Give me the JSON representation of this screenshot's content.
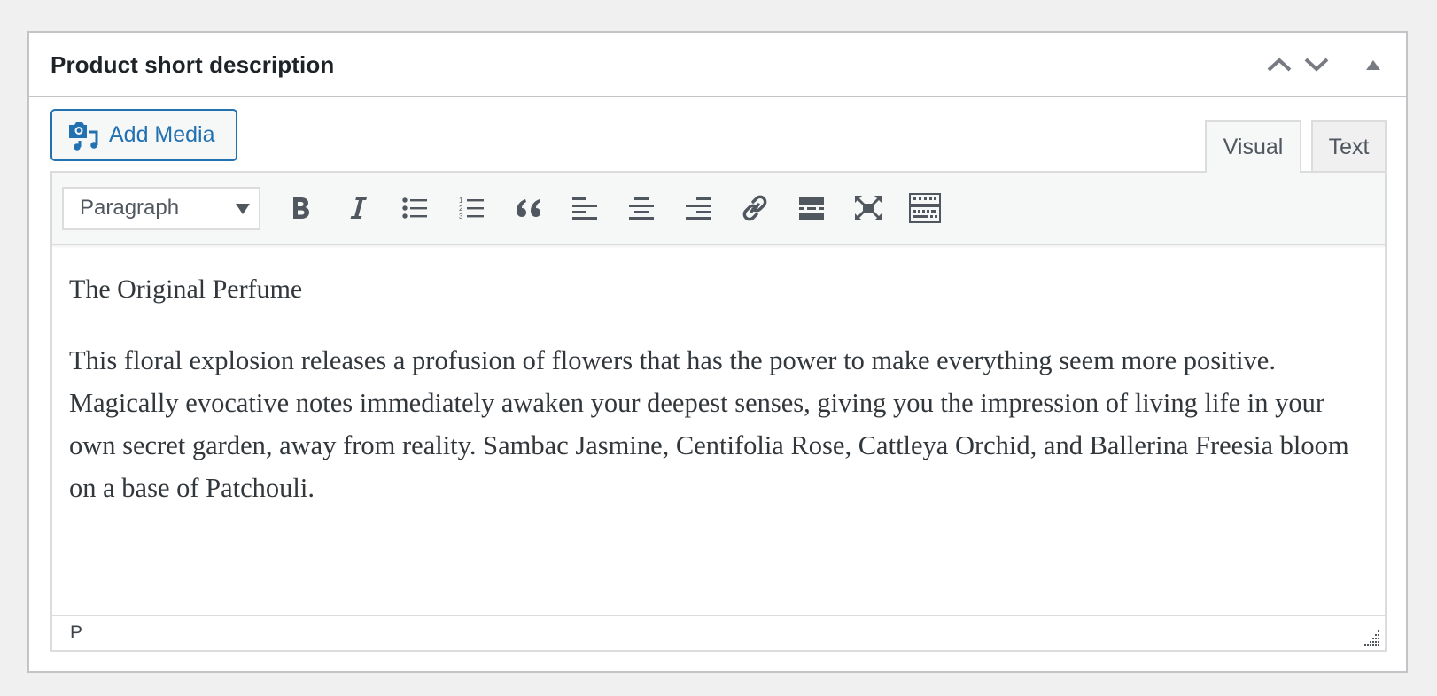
{
  "metabox": {
    "title": "Product short description",
    "actions": [
      {
        "name": "move-up",
        "icon": "chevron-up-icon"
      },
      {
        "name": "move-down",
        "icon": "chevron-down-icon"
      },
      {
        "name": "toggle-panel",
        "icon": "triangle-up-icon"
      }
    ]
  },
  "media": {
    "add_media_label": "Add Media",
    "icon": "media-camera-music-icon"
  },
  "editor_tabs": [
    {
      "label": "Visual",
      "active": true
    },
    {
      "label": "Text",
      "active": false
    }
  ],
  "toolbar": {
    "format_select": {
      "selected": "Paragraph"
    },
    "buttons": [
      {
        "name": "bold",
        "icon": "bold-icon"
      },
      {
        "name": "italic",
        "icon": "italic-icon"
      },
      {
        "name": "bulleted-list",
        "icon": "bulleted-list-icon"
      },
      {
        "name": "numbered-list",
        "icon": "numbered-list-icon"
      },
      {
        "name": "blockquote",
        "icon": "blockquote-icon"
      },
      {
        "name": "align-left",
        "icon": "align-left-icon"
      },
      {
        "name": "align-center",
        "icon": "align-center-icon"
      },
      {
        "name": "align-right",
        "icon": "align-right-icon"
      },
      {
        "name": "insert-link",
        "icon": "link-icon"
      },
      {
        "name": "read-more",
        "icon": "read-more-icon"
      },
      {
        "name": "fullscreen",
        "icon": "fullscreen-icon"
      },
      {
        "name": "toolbar-toggle",
        "icon": "keyboard-toolbar-toggle-icon"
      }
    ]
  },
  "content": {
    "paragraphs": [
      "The Original Perfume",
      "This floral explosion releases a profusion of flowers that has the power to make everything seem more positive. Magically evocative notes immediately awaken your deepest senses, giving you the impression of living life in your own secret garden, away from reality. Sambac Jasmine, Centifolia Rose, Cattleya Orchid, and Ballerina Freesia bloom on a base of Patchouli."
    ]
  },
  "statusbar": {
    "path": "P"
  },
  "colors": {
    "accent": "#2271b1",
    "icon": "#50575e",
    "border": "#c3c4c7",
    "background": "#f0f0f1"
  }
}
